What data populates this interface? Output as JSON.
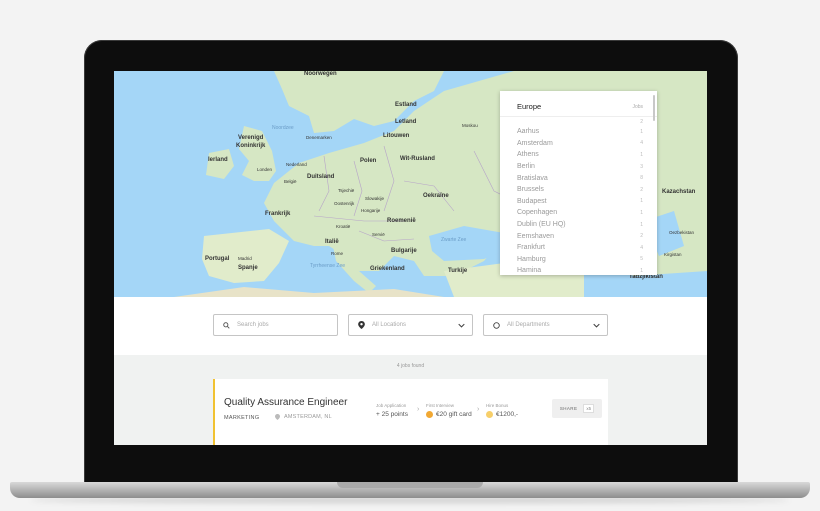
{
  "map": {
    "labels": {
      "noorwegen": "Noorwegen",
      "estland": "Estland",
      "letland": "Letland",
      "litouwen": "Litouwen",
      "denemarken": "Denemarken",
      "noordzee": "Noordzee",
      "verenigd": "Verenigd",
      "koninkrijk": "Koninkrijk",
      "ierland": "Ierland",
      "nederland": "Nederland",
      "londen": "Londen",
      "belgie": "België",
      "duitsland": "Duitsland",
      "polen": "Polen",
      "witrusland": "Wit-Rusland",
      "moskou": "Moskou",
      "frankrijk": "Frankrijk",
      "tsjechie": "Tsjechië",
      "slowakije": "Slowakije",
      "oostenrijk": "Oostenrijk",
      "hongarije": "Hongarije",
      "oekraine": "Oekraïne",
      "kroatie": "Kroatië",
      "roemenie": "Roemenië",
      "servie": "Servië",
      "italie": "Italië",
      "rome": "Rome",
      "bulgarije": "Bulgarije",
      "zwartezee": "Zwarte Zee",
      "portugal": "Portugal",
      "spanje": "Spanje",
      "madrid": "Madrid",
      "tyrrheense": "Tyrrheense Zee",
      "griekenland": "Griekenland",
      "turkije": "Turkije",
      "kazachstan": "Kazachstan",
      "kirgistan": "Kirgistan",
      "tadzjikistan": "Tadzjikistan",
      "oezbekistan": "Oezbekistan"
    }
  },
  "city_panel": {
    "title": "Europe",
    "jobs_header": "Jobs",
    "total_count": "2",
    "cities": [
      {
        "name": "Aarhus",
        "count": "1"
      },
      {
        "name": "Amsterdam",
        "count": "4"
      },
      {
        "name": "Athens",
        "count": "1"
      },
      {
        "name": "Berlin",
        "count": "3"
      },
      {
        "name": "Bratislava",
        "count": "8"
      },
      {
        "name": "Brussels",
        "count": "2"
      },
      {
        "name": "Budapest",
        "count": "1"
      },
      {
        "name": "Copenhagen",
        "count": "1"
      },
      {
        "name": "Dublin (EU HQ)",
        "count": "1"
      },
      {
        "name": "Eemshaven",
        "count": "2"
      },
      {
        "name": "Frankfurt",
        "count": "4"
      },
      {
        "name": "Hamburg",
        "count": "5"
      },
      {
        "name": "Hamina",
        "count": "1"
      }
    ]
  },
  "filters": {
    "search_placeholder": "Search jobs",
    "location_label": "All Locations",
    "department_label": "All Departments"
  },
  "results": {
    "found_text": "4 jobs found",
    "jobs": [
      {
        "title": "Quality Assurance Engineer",
        "department": "MARKETING",
        "location": "AMSTERDAM, NL",
        "steps": [
          {
            "label": "Job Application",
            "value": "+ 25 points"
          },
          {
            "label": "First Interview",
            "value": "€20 gift card"
          },
          {
            "label": "Hire Bonus",
            "value": "€1200,-"
          }
        ],
        "share_label": "SHARE",
        "share_count": "x5"
      }
    ]
  },
  "colors": {
    "accent": "#f1c232",
    "water": "#a4d6f7",
    "land": "#d6e7c4"
  },
  "icons": [
    "search-icon",
    "location-pin-icon",
    "circle-icon",
    "chevron-down-icon",
    "coin-icon"
  ]
}
